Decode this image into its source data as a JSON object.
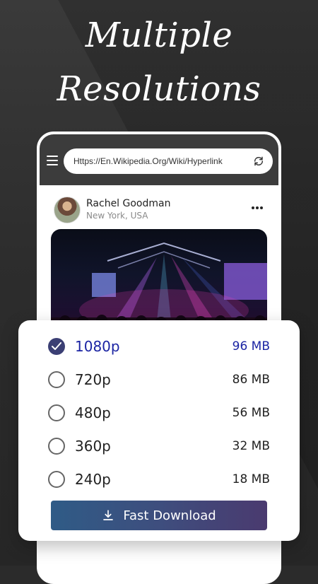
{
  "promo": {
    "line1": "Multiple",
    "line2": "Resolutions"
  },
  "browser": {
    "url": "Https://En.Wikipedia.Org/Wiki/Hyperlink",
    "icons": {
      "menu": "hamburger-menu-icon",
      "refresh": "refresh-icon"
    }
  },
  "post": {
    "author_name": "Rachel Goodman",
    "author_location": "New York, USA",
    "more_icon": "more-horizontal-icon",
    "media_description": "concert stage with screens and purple lights"
  },
  "resolutions": {
    "selected": "1080p",
    "options": [
      {
        "label": "1080p",
        "size": "96 MB"
      },
      {
        "label": "720p",
        "size": "86 MB"
      },
      {
        "label": "480p",
        "size": "56 MB"
      },
      {
        "label": "360p",
        "size": "32 MB"
      },
      {
        "label": "240p",
        "size": "18 MB"
      }
    ],
    "download_label": "Fast Download",
    "download_icon": "download-icon"
  },
  "colors": {
    "accent": "#1b24a3",
    "selected_radio": "#3b3f74",
    "button_gradient_start": "#2f5b86",
    "button_gradient_end": "#4a3a6f"
  }
}
